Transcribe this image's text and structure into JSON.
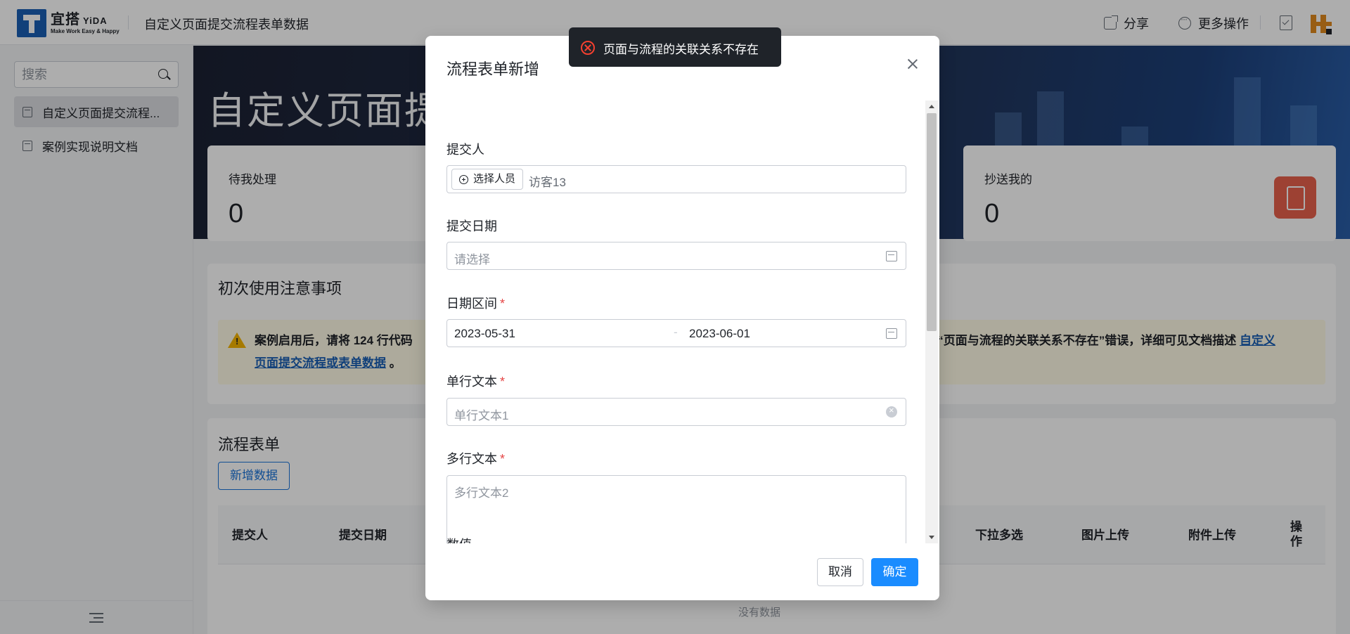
{
  "header": {
    "logo_cn": "宜搭",
    "logo_en": "YiDA",
    "logo_tagline": "Make Work Easy & Happy",
    "app_title": "自定义页面提交流程表单数据",
    "share_label": "分享",
    "more_label": "更多操作"
  },
  "sidebar": {
    "search_placeholder": "搜索",
    "items": [
      {
        "label": "自定义页面提交流程..."
      },
      {
        "label": "案例实现说明文档"
      }
    ]
  },
  "main": {
    "banner_title": "自定义页面提交",
    "stats": [
      {
        "label": "待我处理",
        "value": "0"
      },
      {
        "label": "抄送我的",
        "value": "0"
      }
    ],
    "notice_panel": {
      "title": "初次使用注意事项",
      "text_left": "案例启用后，请将 124 行代码",
      "text_right": "没“页面与流程的关联关系不存在”错误，详细可见文档描述",
      "link_part1": "自定义",
      "link_part2": "页面提交流程或表单数据",
      "suffix": "。"
    },
    "table_panel": {
      "title": "流程表单",
      "add_button": "新增数据",
      "columns_left": [
        "提交人",
        "提交日期"
      ],
      "columns_right": [
        "下拉多选",
        "图片上传",
        "附件上传",
        "操作"
      ],
      "empty_text": "没有数据"
    }
  },
  "dialog": {
    "title": "流程表单新增",
    "fields": {
      "submitter_label": "提交人",
      "select_person_label": "选择人员",
      "submitter_value": "访客13",
      "submit_date_label": "提交日期",
      "submit_date_placeholder": "请选择",
      "date_range_label": "日期区间",
      "date_range_start": "2023-05-31",
      "date_range_sep": "-",
      "date_range_end": "2023-06-01",
      "single_text_label": "单行文本",
      "single_text_value": "单行文本1",
      "multi_text_label": "多行文本",
      "multi_text_placeholder": "多行文本2",
      "number_label": "数值"
    },
    "required_mark": "*",
    "cancel_label": "取消",
    "confirm_label": "确定"
  },
  "toast": {
    "message": "页面与流程的关联关系不存在"
  },
  "colors": {
    "primary": "#1a8cff",
    "error": "#f5402f",
    "stat_icon": "#e8604c",
    "warning": "#f5b400"
  }
}
